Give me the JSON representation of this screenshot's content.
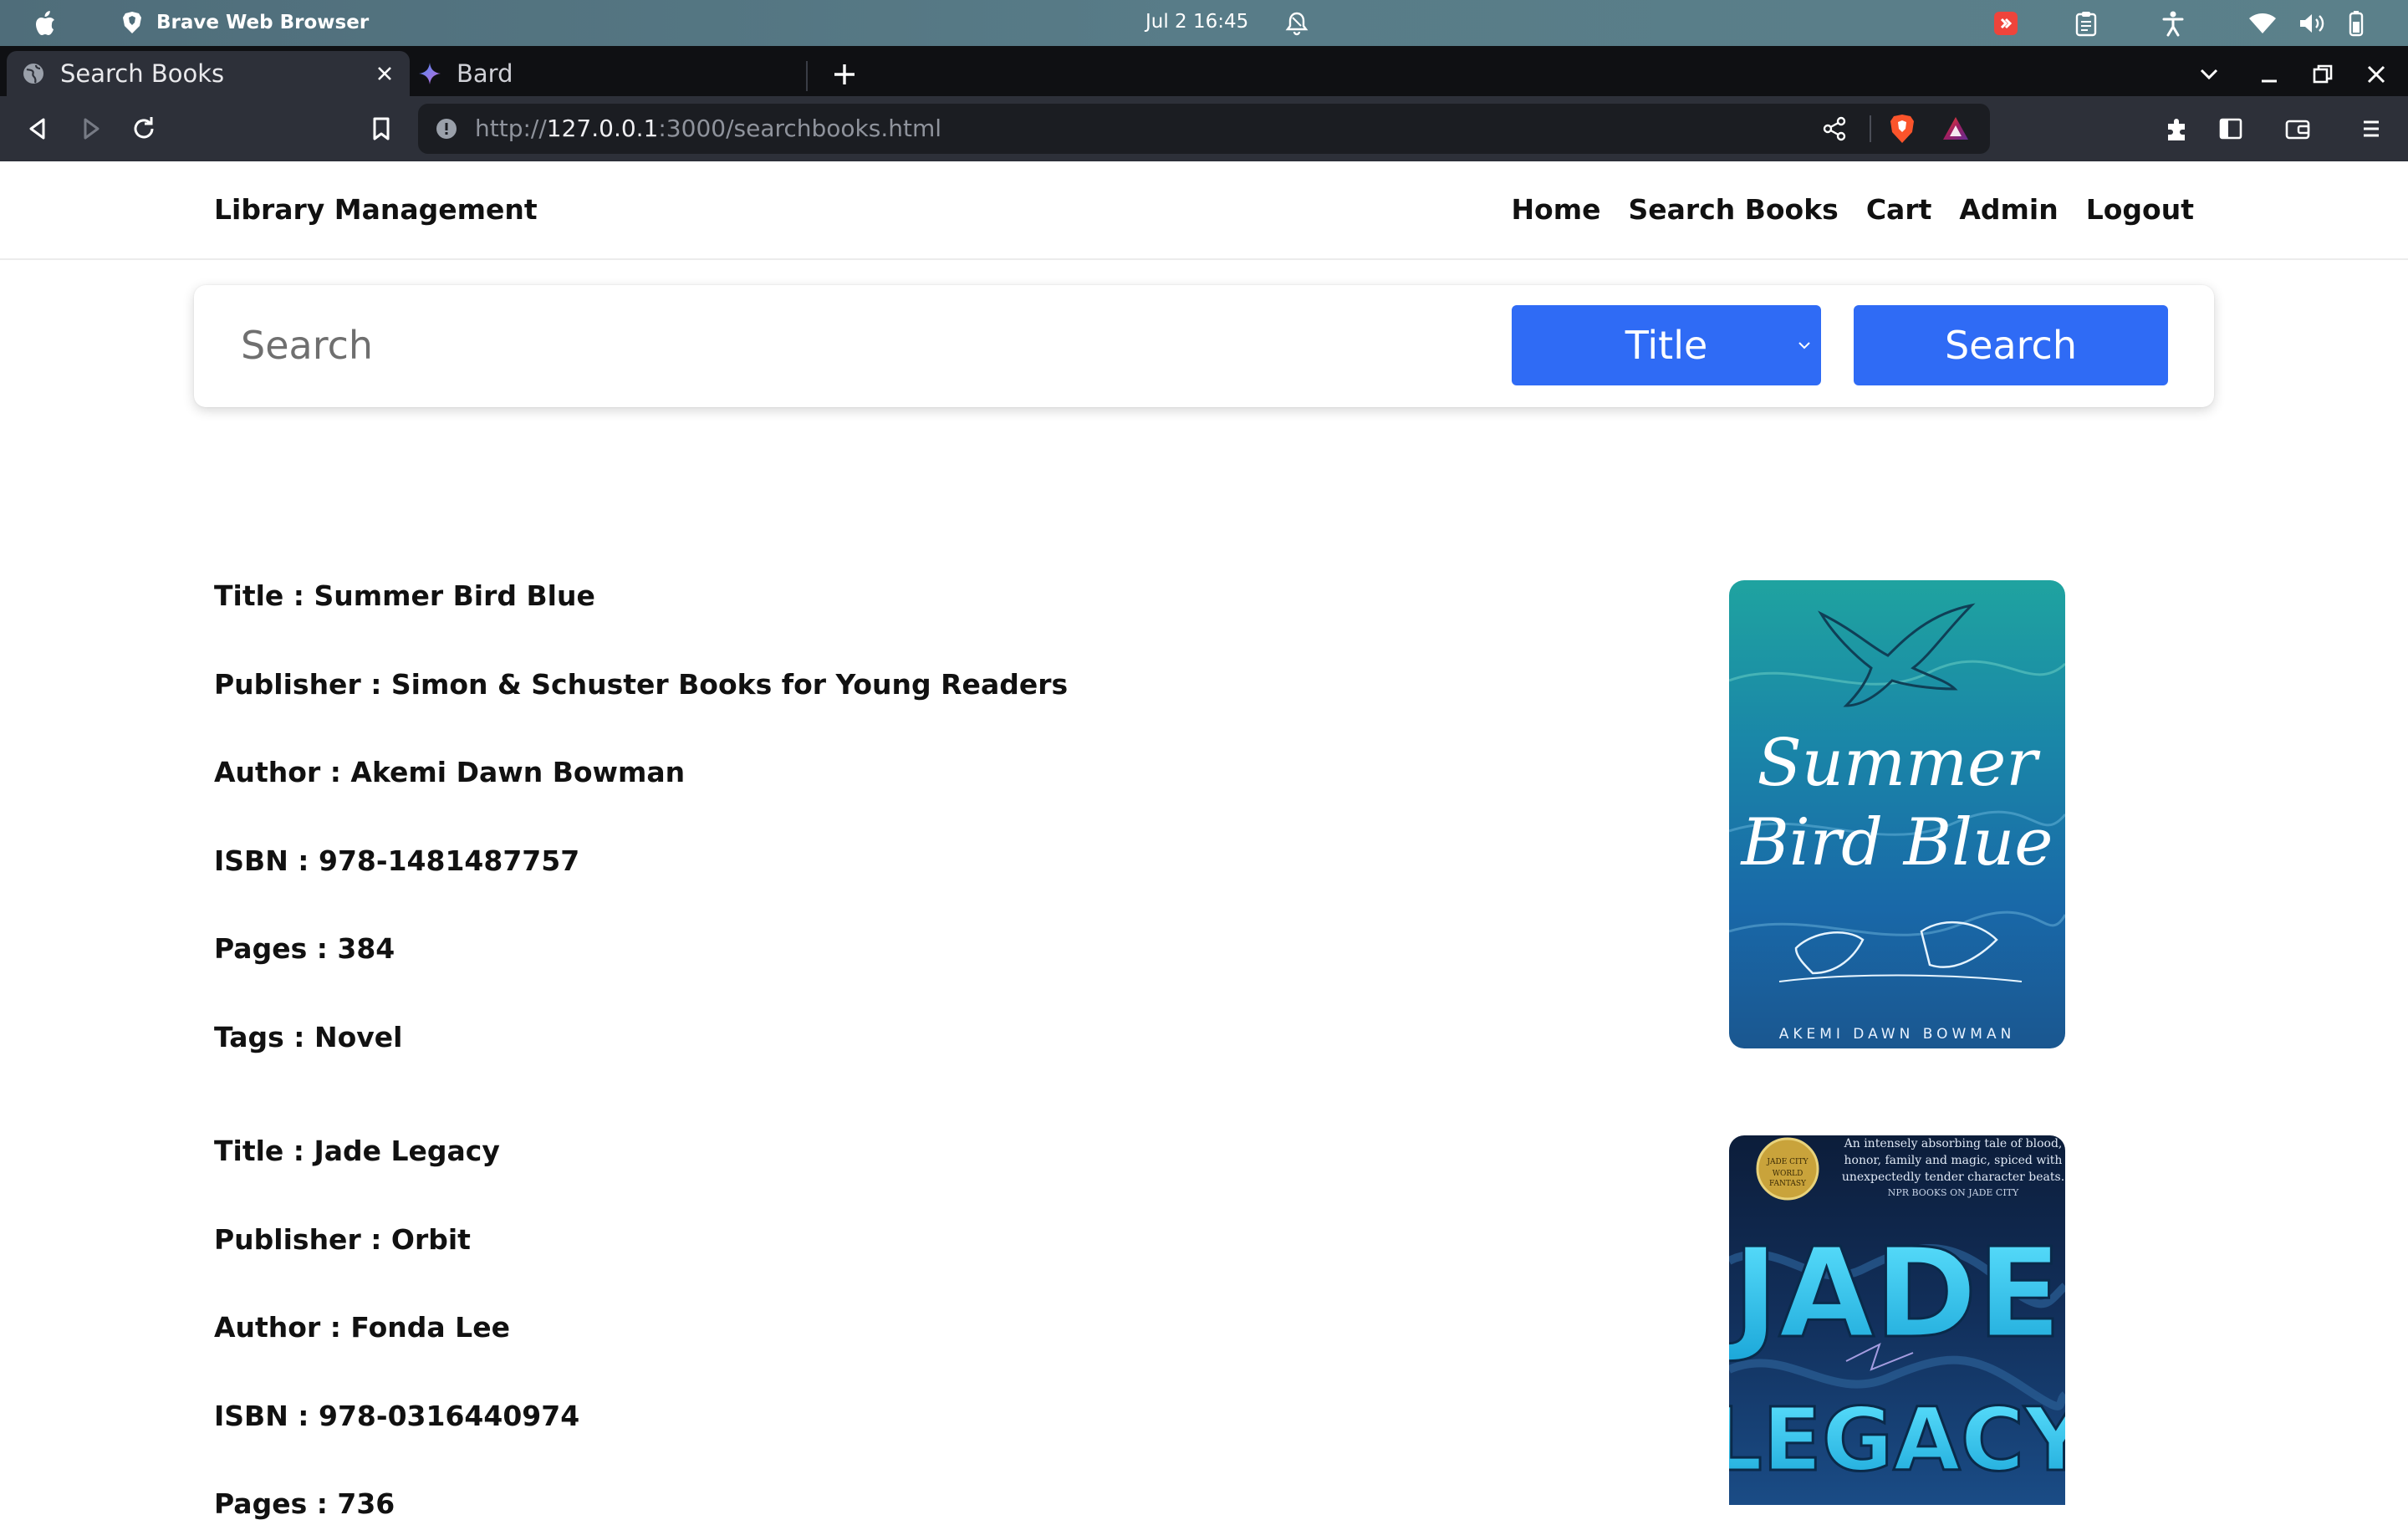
{
  "os": {
    "app_name": "Brave Web Browser",
    "clock": "Jul 2  16:45"
  },
  "browser": {
    "tabs": [
      {
        "label": "Search Books",
        "active": true
      },
      {
        "label": "Bard",
        "active": false
      }
    ],
    "url_scheme": "http://",
    "url_host": "127.0.0.1",
    "url_rest": ":3000/searchbooks.html"
  },
  "site": {
    "brand": "Library Management",
    "nav": [
      "Home",
      "Search Books",
      "Cart",
      "Admin",
      "Logout"
    ]
  },
  "search": {
    "placeholder": "Search",
    "selected_filter": "Title",
    "button_label": "Search"
  },
  "books": [
    {
      "title": "Title : Summer Bird Blue",
      "publisher": "Publisher : Simon & Schuster Books for Young Readers",
      "author": "Author : Akemi Dawn Bowman",
      "isbn": "ISBN : 978-1481487757",
      "pages": "Pages : 384",
      "tags": "Tags : Novel",
      "cover": {
        "line1": "Summer",
        "line2": "Bird Blue",
        "author": "AKEMI DAWN BOWMAN"
      }
    },
    {
      "title": "Title : Jade Legacy",
      "publisher": "Publisher : Orbit",
      "author": "Author : Fonda Lee",
      "isbn": "ISBN : 978-0316440974",
      "pages": "Pages : 736",
      "cover": {
        "line1": "JADE",
        "line2": "LEGACY",
        "quote1": "An intensely absorbing tale of blood,",
        "quote2": "honor, family and magic, spiced with",
        "quote3": "unexpectedly tender character beats.",
        "quote_src": "NPR BOOKS ON JADE CITY"
      }
    }
  ]
}
